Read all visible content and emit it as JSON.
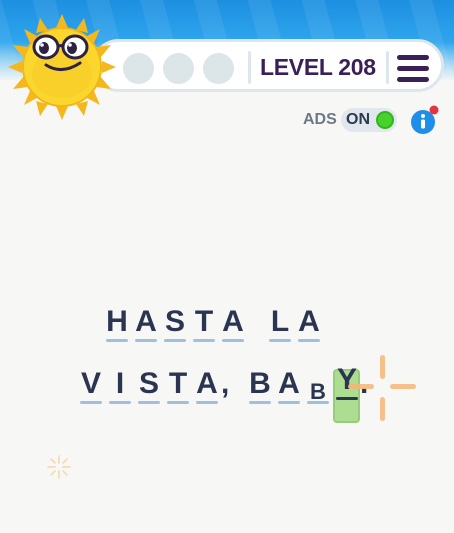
{
  "header": {
    "level_label": "LEVEL 208",
    "hint_slots": 3
  },
  "ads": {
    "label": "ADS",
    "toggle_state": "ON",
    "notification": true
  },
  "phrase": {
    "line1": [
      "H",
      "A",
      "S",
      "T",
      "A",
      " ",
      "L",
      "A"
    ],
    "line2": [
      "V",
      "I",
      "S",
      "T",
      "A",
      ",",
      " ",
      "B",
      "A",
      "B",
      "Y",
      "."
    ],
    "active_letter": "Y"
  },
  "colors": {
    "level_text": "#3a1f58",
    "letters": "#2b3551",
    "underline": "#9fc0dd",
    "active_slot": "#a6db86",
    "toggle_on": "#45d22b",
    "info_blue": "#1f8ee8",
    "sparkle": "#f5b777"
  },
  "icons": {
    "menu": "hamburger-menu-icon",
    "info": "info-icon",
    "mascot": "sun-mascot"
  }
}
